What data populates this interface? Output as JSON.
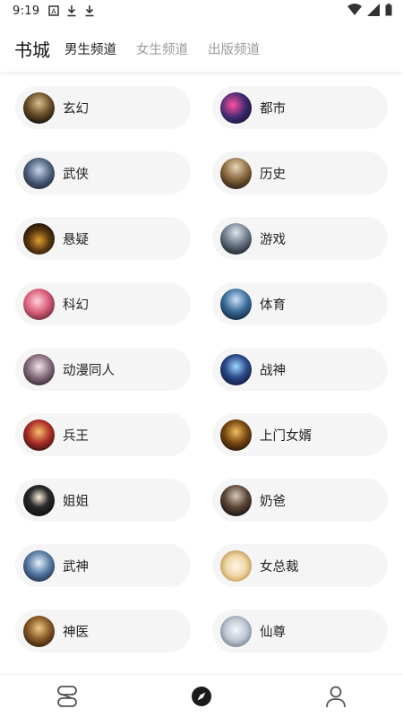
{
  "status_bar": {
    "time": "9:19",
    "icons": [
      "notification-a-icon",
      "download-icon",
      "download-icon",
      "wifi-icon",
      "signal-icon",
      "battery-icon"
    ]
  },
  "header": {
    "title": "书城",
    "tabs": [
      {
        "label": "男生频道",
        "active": true
      },
      {
        "label": "女生频道",
        "active": false
      },
      {
        "label": "出版频道",
        "active": false
      }
    ]
  },
  "categories": [
    {
      "label": "玄幻"
    },
    {
      "label": "都市"
    },
    {
      "label": "武侠"
    },
    {
      "label": "历史"
    },
    {
      "label": "悬疑"
    },
    {
      "label": "游戏"
    },
    {
      "label": "科幻"
    },
    {
      "label": "体育"
    },
    {
      "label": "动漫同人"
    },
    {
      "label": "战神"
    },
    {
      "label": "兵王"
    },
    {
      "label": "上门女婿"
    },
    {
      "label": "姐姐"
    },
    {
      "label": "奶爸"
    },
    {
      "label": "武神"
    },
    {
      "label": "女总裁"
    },
    {
      "label": "神医"
    },
    {
      "label": "仙尊"
    }
  ],
  "bottom_nav": [
    {
      "icon": "bookshelf-icon",
      "active": false
    },
    {
      "icon": "compass-icon",
      "active": true
    },
    {
      "icon": "user-icon",
      "active": false
    }
  ],
  "colors": {
    "card_bg": "#f5f5f5",
    "active_tab": "#222222",
    "inactive_tab": "#9a9a9a"
  }
}
